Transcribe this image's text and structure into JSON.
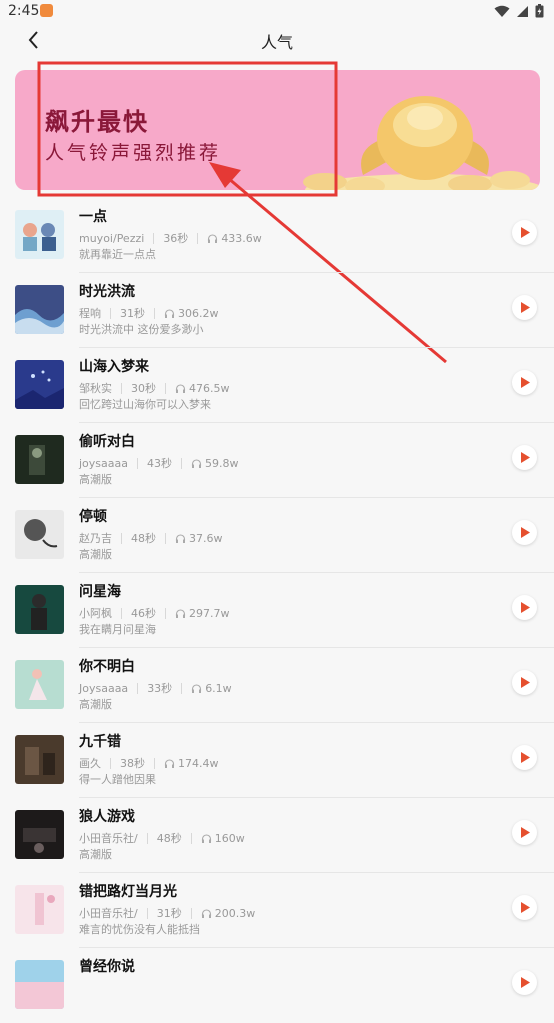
{
  "status_bar": {
    "time": "2:45"
  },
  "header": {
    "title": "人气"
  },
  "banner": {
    "headline": "飙升最快",
    "subtitle": "人气铃声强烈推荐"
  },
  "colors": {
    "accent": "#e5502f",
    "annotation": "#e53935",
    "banner_bg": "#f7a9c9"
  },
  "songs": [
    {
      "title": "一点",
      "artist": "muyoi/Pezzi",
      "duration": "36秒",
      "plays": "433.6w",
      "desc": "就再靠近一点点"
    },
    {
      "title": "时光洪流",
      "artist": "程响",
      "duration": "31秒",
      "plays": "306.2w",
      "desc": "时光洪流中 这份爱多渺小"
    },
    {
      "title": "山海入梦来",
      "artist": "邹秋实",
      "duration": "30秒",
      "plays": "476.5w",
      "desc": "回忆跨过山海你可以入梦来"
    },
    {
      "title": "偷听对白",
      "artist": "joysaaaa",
      "duration": "43秒",
      "plays": "59.8w",
      "desc": "高潮版"
    },
    {
      "title": "停顿",
      "artist": "赵乃吉",
      "duration": "48秒",
      "plays": "37.6w",
      "desc": "高潮版"
    },
    {
      "title": "问星海",
      "artist": "小阿枫",
      "duration": "46秒",
      "plays": "297.7w",
      "desc": "我在瞒月问星海"
    },
    {
      "title": "你不明白",
      "artist": "Joysaaaa",
      "duration": "33秒",
      "plays": "6.1w",
      "desc": "高潮版"
    },
    {
      "title": "九千错",
      "artist": "画久",
      "duration": "38秒",
      "plays": "174.4w",
      "desc": "得一人蹭他因果"
    },
    {
      "title": "狼人游戏",
      "artist": "小田音乐社/",
      "duration": "48秒",
      "plays": "160w",
      "desc": "高潮版"
    },
    {
      "title": "错把路灯当月光",
      "artist": "小田音乐社/",
      "duration": "31秒",
      "plays": "200.3w",
      "desc": "难言的忧伤没有人能抵挡"
    },
    {
      "title": "曾经你说",
      "artist": "",
      "duration": "",
      "plays": "",
      "desc": ""
    }
  ]
}
